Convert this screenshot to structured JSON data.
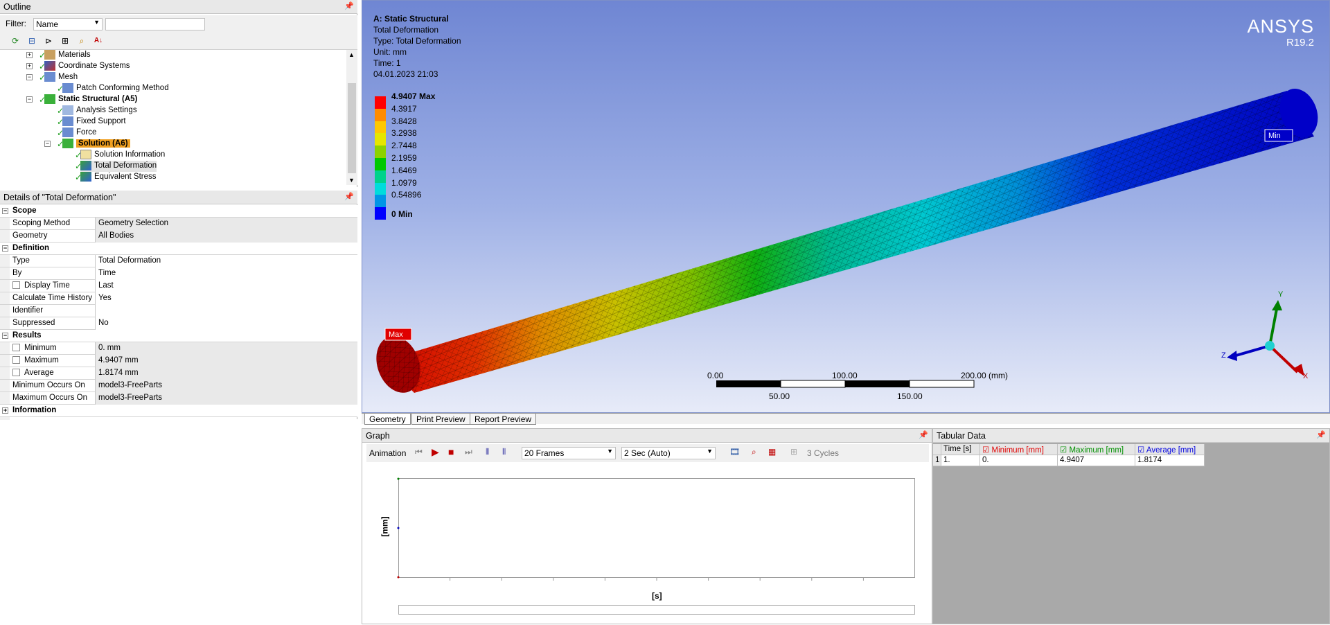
{
  "outline": {
    "title": "Outline",
    "filter_label": "Filter:",
    "filter_value": "Name",
    "search_value": "",
    "tree": [
      {
        "label": "Materials"
      },
      {
        "label": "Coordinate Systems"
      },
      {
        "label": "Mesh"
      },
      {
        "label": "Patch Conforming Method"
      },
      {
        "label": "Static Structural (A5)"
      },
      {
        "label": "Analysis Settings"
      },
      {
        "label": "Fixed Support"
      },
      {
        "label": "Force"
      },
      {
        "label": "Solution (A6)"
      },
      {
        "label": "Solution Information"
      },
      {
        "label": "Total Deformation"
      },
      {
        "label": "Equivalent Stress"
      }
    ]
  },
  "details": {
    "title": "Details of \"Total Deformation\"",
    "groups": {
      "scope": "Scope",
      "definition": "Definition",
      "results": "Results",
      "information": "Information"
    },
    "rows": {
      "scoping_method": {
        "key": "Scoping Method",
        "value": "Geometry Selection"
      },
      "geometry": {
        "key": "Geometry",
        "value": "All Bodies"
      },
      "type": {
        "key": "Type",
        "value": "Total Deformation"
      },
      "by": {
        "key": "By",
        "value": "Time"
      },
      "display_time": {
        "key": "Display Time",
        "value": "Last"
      },
      "calc_time_history": {
        "key": "Calculate Time History",
        "value": "Yes"
      },
      "identifier": {
        "key": "Identifier",
        "value": ""
      },
      "suppressed": {
        "key": "Suppressed",
        "value": "No"
      },
      "minimum": {
        "key": "Minimum",
        "value": "0. mm"
      },
      "maximum": {
        "key": "Maximum",
        "value": "4.9407 mm"
      },
      "average": {
        "key": "Average",
        "value": "1.8174 mm"
      },
      "min_occurs": {
        "key": "Minimum Occurs On",
        "value": "model3-FreeParts"
      },
      "max_occurs": {
        "key": "Maximum Occurs On",
        "value": "model3-FreeParts"
      }
    }
  },
  "viewport": {
    "header": {
      "title": "A: Static Structural",
      "line1": "Total Deformation",
      "line2": "Type: Total Deformation",
      "line3": "Unit: mm",
      "line4": "Time: 1",
      "line5": "04.01.2023 21:03"
    },
    "brand": "ANSYS",
    "version": "R19.2",
    "legend": [
      {
        "label": "4.9407 Max",
        "color": "#ff0000"
      },
      {
        "label": "4.3917",
        "color": "#ff8c00"
      },
      {
        "label": "3.8428",
        "color": "#ffc800"
      },
      {
        "label": "3.2938",
        "color": "#e6e600"
      },
      {
        "label": "2.7448",
        "color": "#8cd200"
      },
      {
        "label": "2.1959",
        "color": "#00c800"
      },
      {
        "label": "1.6469",
        "color": "#00d28c"
      },
      {
        "label": "1.0979",
        "color": "#00dcdc"
      },
      {
        "label": "0.54896",
        "color": "#0096e6"
      },
      {
        "label": "0 Min",
        "color": "#0000ff"
      }
    ],
    "max_tag": "Max",
    "min_tag": "Min",
    "scale": {
      "t0": "0.00",
      "t100": "100.00",
      "t200": "200.00 (mm)",
      "t50": "50.00",
      "t150": "150.00"
    },
    "triad": {
      "x": "X",
      "y": "Y",
      "z": "Z"
    }
  },
  "tabs": [
    "Geometry",
    "Print Preview",
    "Report Preview"
  ],
  "graph": {
    "title": "Graph",
    "animation_label": "Animation",
    "frames": "20 Frames",
    "duration": "2 Sec (Auto)",
    "cycles": "3 Cycles",
    "ylabel": "[mm]",
    "xlabel": "[s]"
  },
  "tabular": {
    "title": "Tabular Data",
    "headers": [
      "Time [s]",
      "Minimum [mm]",
      "Maximum [mm]",
      "Average [mm]"
    ],
    "header_colors": [
      "#000000",
      "#e00000",
      "#009000",
      "#0000e0"
    ],
    "rows": [
      {
        "idx": "1",
        "time": "1.",
        "min": "0.",
        "max": "4.9407",
        "avg": "1.8174"
      }
    ]
  },
  "icons": [
    "refresh-icon",
    "tree-icon",
    "filter-icon",
    "expand-icon",
    "search-icon",
    "sort-icon",
    "pin-icon",
    "checkmark-icon",
    "play-icon",
    "stop-icon",
    "prev-frame-icon",
    "next-frame-icon",
    "export-video-icon",
    "zoom-icon"
  ]
}
